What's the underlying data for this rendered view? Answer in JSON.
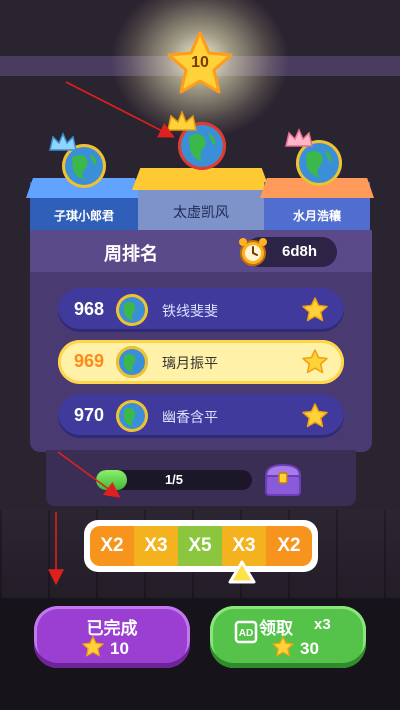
{
  "colors": {
    "background": "#2a2330",
    "board": "#4a3a72",
    "row": "#3f3a9c",
    "row_highlight": "#fff1a8",
    "done_button": "#9a3fd1",
    "claim_button": "#55c24a",
    "arrow": "#e0201c"
  },
  "top_star": {
    "value": "10",
    "icon": "star-icon"
  },
  "podium": {
    "left": {
      "name": "子琪小郎君",
      "avatar": "globe-icon",
      "crown": "blue-crown-icon"
    },
    "middle": {
      "name": "太虚凯风",
      "avatar": "globe-icon",
      "crown": "gold-crown-icon"
    },
    "right": {
      "name": "水月浩穰",
      "avatar": "globe-icon",
      "crown": "pink-crown-icon"
    }
  },
  "board": {
    "title": "周排名",
    "timer": "6d8h",
    "rows": [
      {
        "rank": "968",
        "name": "铁线斐斐",
        "highlight": false
      },
      {
        "rank": "969",
        "name": "璃月振平",
        "highlight": true
      },
      {
        "rank": "970",
        "name": "幽香含平",
        "highlight": false
      }
    ]
  },
  "progress": {
    "text": "1/5",
    "value": 0.2
  },
  "multipliers": [
    {
      "label": "X2",
      "color": "#f7941d"
    },
    {
      "label": "X3",
      "color": "#f5b21f"
    },
    {
      "label": "X5",
      "color": "#8cc63f"
    },
    {
      "label": "X3",
      "color": "#f5b21f"
    },
    {
      "label": "X2",
      "color": "#f7941d"
    }
  ],
  "buttons": {
    "done": {
      "label": "已完成",
      "value": "10"
    },
    "claim": {
      "label": "领取",
      "multiplier": "x3",
      "value": "30",
      "ad_icon": "ad-icon"
    }
  }
}
